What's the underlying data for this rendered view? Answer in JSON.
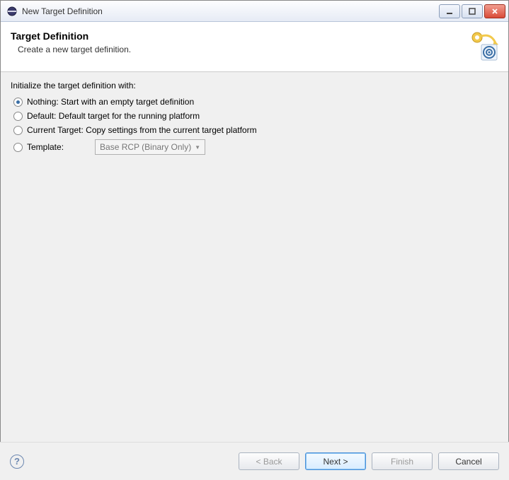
{
  "window": {
    "title": "New Target Definition"
  },
  "header": {
    "title": "Target Definition",
    "description": "Create a new target definition."
  },
  "init": {
    "prompt": "Initialize the target definition with:",
    "options": [
      {
        "label": "Nothing: Start with an empty target definition",
        "selected": true
      },
      {
        "label": "Default: Default target for the running platform",
        "selected": false
      },
      {
        "label": "Current Target: Copy settings from the current target platform",
        "selected": false
      },
      {
        "label": "Template:",
        "selected": false
      }
    ],
    "template_selected": "Base RCP (Binary Only)"
  },
  "buttons": {
    "back": "< Back",
    "next": "Next >",
    "finish": "Finish",
    "cancel": "Cancel"
  }
}
